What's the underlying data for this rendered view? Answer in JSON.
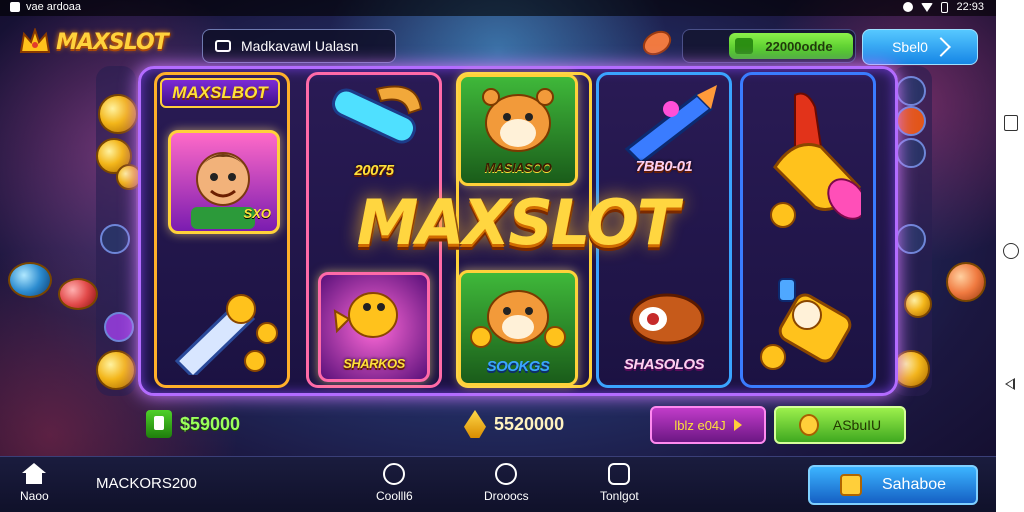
{
  "status_bar": {
    "left_text": "vae ardoaa",
    "time": "22:93"
  },
  "header": {
    "logo": "MAXSLOT",
    "search_label": "Madkavawl Ualasn",
    "coins_label": "22000odde",
    "signin_label": "Sbel0"
  },
  "machine": {
    "tile_header": "MAXSLBOT",
    "center_logo": "MAXSLOT",
    "tiles": [
      {
        "label": "",
        "art": "boy-character"
      },
      {
        "label": "20075",
        "art": "pipe"
      },
      {
        "label": "MASIASOO",
        "art": "hamster"
      },
      {
        "label": "7BB0-01",
        "art": "rocket"
      },
      {
        "label": "",
        "art": "golden-horn"
      },
      {
        "label": "",
        "art": "coin-rocket"
      },
      {
        "label": "SHARKOS",
        "art": "golden-fish"
      },
      {
        "label": "SOOKGS",
        "art": "hamster-coins"
      },
      {
        "label": "SHASOLOS",
        "art": "fish"
      },
      {
        "label": "",
        "art": "golden-cannon"
      }
    ],
    "boy_tag": "SXO"
  },
  "info_bar": {
    "balance_left": "$59000",
    "balance_mid": "5520000",
    "bet_label": "lblz e04J",
    "auto_label": "ASbuIU"
  },
  "bottom_nav": {
    "home_label": "Naoo",
    "username": "MACKORS200",
    "item1_label": "Coolll6",
    "item2_label": "Drooocs",
    "item3_label": "Tonlgot",
    "action_label": "Sahaboe"
  },
  "colors": {
    "accent_gold": "#ffd640",
    "frame_purple": "#b36cff",
    "button_blue": "#1686e6",
    "button_green": "#39b81f"
  }
}
